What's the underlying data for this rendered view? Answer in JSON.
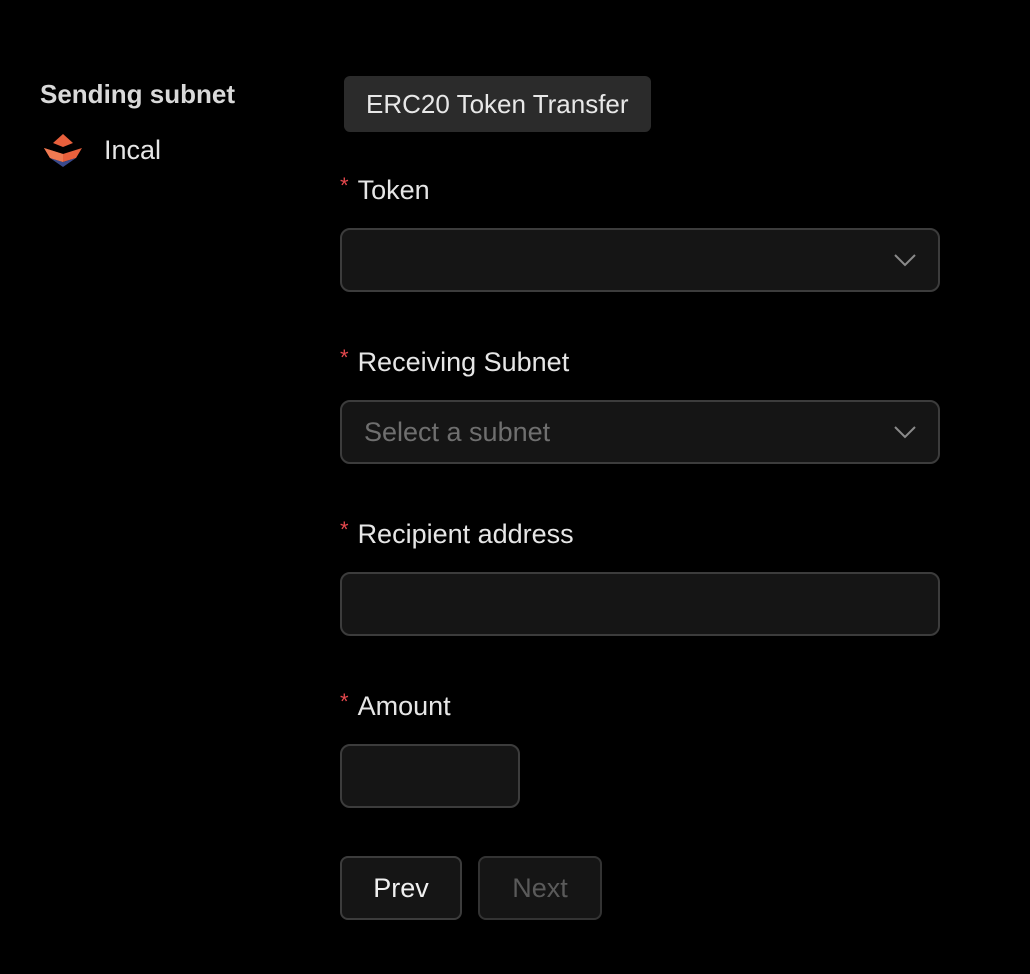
{
  "sidebar": {
    "title": "Sending subnet",
    "subnet": {
      "name": "Incal",
      "icon": "incal-logo-icon"
    }
  },
  "main": {
    "badge": "ERC20 Token Transfer",
    "required_marker": "*",
    "fields": {
      "token": {
        "label": "Token",
        "value": "",
        "placeholder": ""
      },
      "receiving_subnet": {
        "label": "Receiving Subnet",
        "placeholder": "Select a subnet"
      },
      "recipient_address": {
        "label": "Recipient address",
        "value": "",
        "placeholder": ""
      },
      "amount": {
        "label": "Amount",
        "value": "",
        "placeholder": ""
      }
    },
    "buttons": {
      "prev": "Prev",
      "next": "Next"
    }
  },
  "colors": {
    "background": "#000000",
    "required": "#e5484d",
    "logo_orange": "#e8603c",
    "logo_blue": "#3a4a8c"
  }
}
